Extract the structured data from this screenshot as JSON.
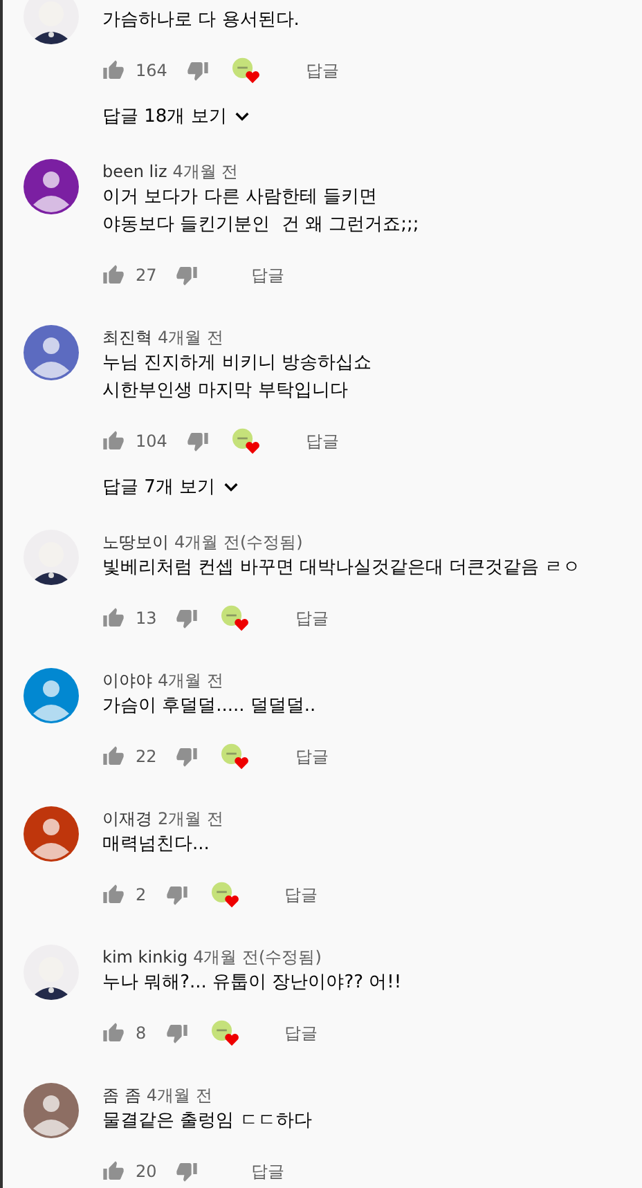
{
  "comments": [
    {
      "text": "가슴하나로 다 용서된다.",
      "likes": "164",
      "hearted": true,
      "reply_label": "답글",
      "replies": "답글 18개 보기"
    },
    {
      "author": "been liz",
      "time": "4개월 전",
      "avatar": {
        "kind": "default",
        "color": "#7b1fa2"
      },
      "text": "이거 보다가 다른 사람한테 들키면\n야동보다 들킨기분인  건 왜 그런거죠;;;",
      "likes": "27",
      "hearted": false,
      "reply_label": "답글"
    },
    {
      "author": "최진혁",
      "time": "4개월 전",
      "avatar": {
        "kind": "default",
        "color": "#5c6bc0"
      },
      "text": "누님 진지하게 비키니 방송하십쇼\n시한부인생 마지막 부탁입니다",
      "likes": "104",
      "hearted": true,
      "reply_label": "답글",
      "replies": "답글 7개 보기"
    },
    {
      "author": "노땅보이",
      "time": "4개월 전(수정됨)",
      "text": "빛베리처럼 컨셉 바꾸면 대박나실것같은대 더큰것같음 ㄹㅇ",
      "likes": "13",
      "hearted": true,
      "reply_label": "답글"
    },
    {
      "author": "이야야",
      "time": "4개월 전",
      "avatar": {
        "kind": "default",
        "color": "#0288d1"
      },
      "text": "가슴이 후덜덜..... 덜덜덜..",
      "likes": "22",
      "hearted": true,
      "reply_label": "답글"
    },
    {
      "author": "이재경",
      "time": "2개월 전",
      "avatar": {
        "kind": "default",
        "color": "#bf360c"
      },
      "text": "매력넘친다...",
      "likes": "2",
      "hearted": true,
      "reply_label": "답글"
    },
    {
      "author": "kim kinkig",
      "time": "4개월 전(수정됨)",
      "text": "누나 뭐해?... 유툽이 장난이야?? 어!!",
      "likes": "8",
      "hearted": true,
      "reply_label": "답글"
    },
    {
      "author": "좀 좀",
      "time": "4개월 전",
      "avatar": {
        "kind": "default",
        "color": "#8d6e63"
      },
      "text": "물결같은 출렁임 ㄷㄷ하다",
      "likes": "20",
      "hearted": false,
      "reply_label": "답글"
    }
  ]
}
